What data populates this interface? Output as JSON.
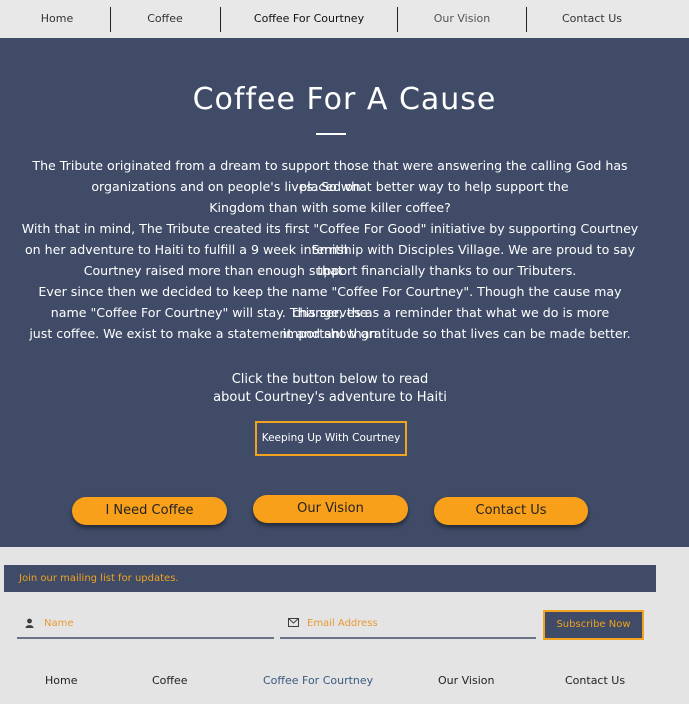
{
  "nav": {
    "items": [
      "Home",
      "Coffee",
      "Coffee For Courtney",
      "Our Vision",
      "Contact Us"
    ]
  },
  "hero": {
    "title": "Coffee For A Cause",
    "paragraph_lines": [
      "The Tribute originated from a dream to support those that were answering the calling God has placed on",
      "organizations and on people's lives. So what better way to help support the",
      "Kingdom than with some killer coffee?",
      "With that in mind, The Tribute created its first \"Coffee For Good\" initiative by supporting Courtney Smith",
      "on her adventure to Haiti to fulfill a 9 week internship with Disciples Village. We are proud to say that",
      "Courtney raised more than enough support financially thanks to our Tributers.",
      "Ever since then we decided to keep the name \"Coffee For Courtney\". Though the cause may change, the",
      "name \"Coffee For Courtney\" will stay. This serves as a reminder that what we do is more important than",
      "just coffee. We exist to make a statement and show gratitude so that lives can be made better."
    ],
    "cta_line1": "Click the button below to read",
    "cta_line2": "about Courtney's adventure to Haiti",
    "keep_up_button": "Keeping Up With Courtney",
    "pill_buttons": [
      "I Need Coffee",
      "Our Vision",
      "Contact Us"
    ],
    "accent_color": "#f9a01b",
    "background_color": "#3f4b67"
  },
  "mailing": {
    "heading": "Join our mailing list for updates.",
    "name_placeholder": "Name",
    "email_placeholder": "Email Address",
    "subscribe_label": "Subscribe Now",
    "name_icon": "user-icon",
    "email_icon": "envelope-icon"
  },
  "footer_nav": {
    "items": [
      "Home",
      "Coffee",
      "Coffee For Courtney",
      "Our Vision",
      "Contact Us"
    ],
    "active": "Coffee For Courtney"
  }
}
